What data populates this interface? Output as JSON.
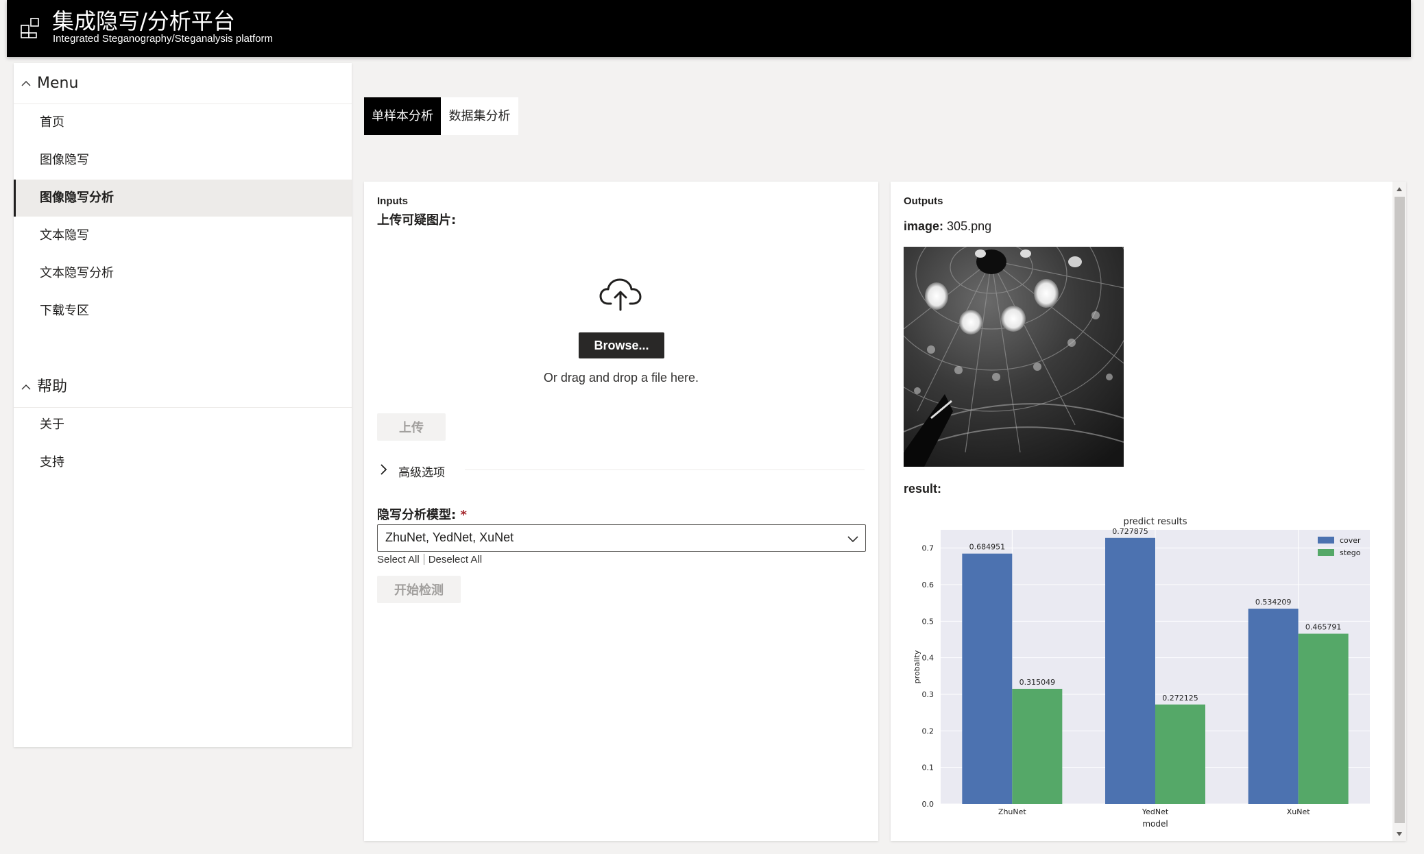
{
  "header": {
    "title": "集成隐写/分析平台",
    "subtitle": "Integrated Steganography/Steganalysis platform",
    "logo_icon": "dashboard-grid-icon"
  },
  "sidebar": {
    "groups": [
      {
        "title": "Menu",
        "items": [
          {
            "label": "首页",
            "active": false
          },
          {
            "label": "图像隐写",
            "active": false
          },
          {
            "label": "图像隐写分析",
            "active": true
          },
          {
            "label": "文本隐写",
            "active": false
          },
          {
            "label": "文本隐写分析",
            "active": false
          },
          {
            "label": "下载专区",
            "active": false
          }
        ]
      },
      {
        "title": "帮助",
        "items": [
          {
            "label": "关于",
            "active": false
          },
          {
            "label": "支持",
            "active": false
          }
        ]
      }
    ]
  },
  "tabs": [
    {
      "label": "单样本分析",
      "active": true
    },
    {
      "label": "数据集分析",
      "active": false
    }
  ],
  "inputs": {
    "heading": "Inputs",
    "upload_label": "上传可疑图片:",
    "browse_label": "Browse...",
    "drag_drop_text": "Or drag and drop a file here.",
    "upload_button": "上传",
    "advanced_options": "高级选项",
    "model_label": "隐写分析模型:",
    "required_mark": "*",
    "model_value": "ZhuNet, YedNet, XuNet",
    "select_all": "Select All",
    "deselect_all": "Deselect All",
    "start_button": "开始检测"
  },
  "outputs": {
    "heading": "Outputs",
    "image_key": "image:",
    "image_name": "305.png",
    "result_label": "result:"
  },
  "chart_data": {
    "type": "bar",
    "title": "predict results",
    "xlabel": "model",
    "ylabel": "probality",
    "categories": [
      "ZhuNet",
      "YedNet",
      "XuNet"
    ],
    "series": [
      {
        "name": "cover",
        "values": [
          0.684951,
          0.727875,
          0.534209
        ],
        "labels": [
          "0.684951",
          "0.727875",
          "0.534209"
        ],
        "color": "#4c72b0"
      },
      {
        "name": "stego",
        "values": [
          0.315049,
          0.272125,
          0.465791
        ],
        "labels": [
          "0.315049",
          "0.272125",
          "0.465791"
        ],
        "color": "#55a868"
      }
    ],
    "yticks": [
      "0.0",
      "0.1",
      "0.2",
      "0.3",
      "0.4",
      "0.5",
      "0.6",
      "0.7"
    ],
    "ylim": [
      0,
      0.75
    ],
    "grid": true,
    "legend": "top-right",
    "background": "#eaeaf2"
  }
}
